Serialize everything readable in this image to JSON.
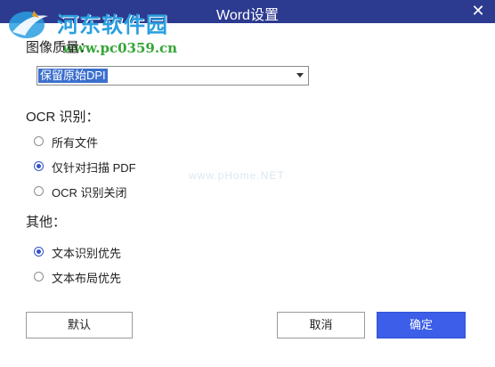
{
  "window": {
    "title": "Word设置"
  },
  "watermark": {
    "site_name": "河东软件园",
    "url": "www.pc0359.cn",
    "faint_text": "www.pHome.NET"
  },
  "image_quality": {
    "label": "图像质量：",
    "selected": "保留原始DPI"
  },
  "ocr": {
    "label": "OCR 识别：",
    "options": [
      {
        "label": "所有文件",
        "checked": false
      },
      {
        "label": "仅针对扫描 PDF",
        "checked": true
      },
      {
        "label": "OCR 识别关闭",
        "checked": false
      }
    ]
  },
  "other": {
    "label": "其他：",
    "options": [
      {
        "label": "文本识别优先",
        "checked": true
      },
      {
        "label": "文本布局优先",
        "checked": false
      }
    ]
  },
  "buttons": {
    "default": "默认",
    "cancel": "取消",
    "ok": "确定"
  },
  "colors": {
    "titlebar": "#2c3a8f",
    "primary": "#3c5ee8",
    "selection": "#3c6fce"
  },
  "icons": {
    "close": "close-icon",
    "dropdown": "chevron-down-icon",
    "logo": "watermark-logo-icon"
  }
}
